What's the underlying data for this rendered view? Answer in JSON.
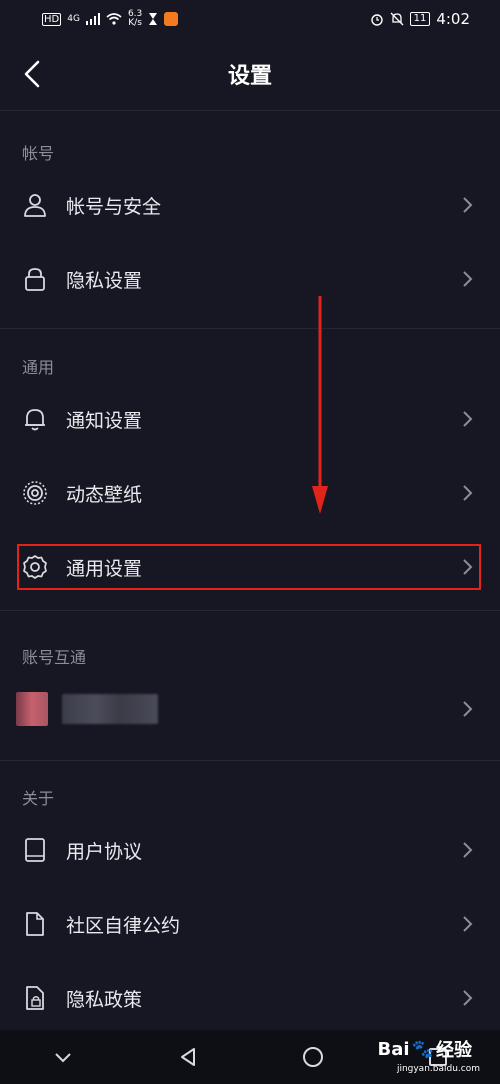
{
  "status_bar": {
    "net_type": "HD",
    "signal": "4G",
    "net_speed_value": "6.3",
    "net_speed_unit": "K/s",
    "battery": "11",
    "time": "4:02"
  },
  "header": {
    "title": "设置"
  },
  "sections": [
    {
      "title": "帐号",
      "items": [
        {
          "label": "帐号与安全",
          "icon": "person-icon"
        },
        {
          "label": "隐私设置",
          "icon": "lock-icon"
        }
      ]
    },
    {
      "title": "通用",
      "items": [
        {
          "label": "通知设置",
          "icon": "bell-icon"
        },
        {
          "label": "动态壁纸",
          "icon": "concentric-circles-icon"
        },
        {
          "label": "通用设置",
          "icon": "gear-icon"
        }
      ]
    },
    {
      "title": "账号互通",
      "items": []
    },
    {
      "title": "关于",
      "items": [
        {
          "label": "用户协议",
          "icon": "book-icon"
        },
        {
          "label": "社区自律公约",
          "icon": "document-icon"
        },
        {
          "label": "隐私政策",
          "icon": "lock-document-icon"
        }
      ]
    }
  ],
  "watermark": {
    "brand": "Bai",
    "brand_tail": "经验",
    "url": "jingyan.baidu.com"
  },
  "colors": {
    "background": "#161722",
    "highlight": "#e2231a",
    "section_text": "#8c8d99"
  }
}
